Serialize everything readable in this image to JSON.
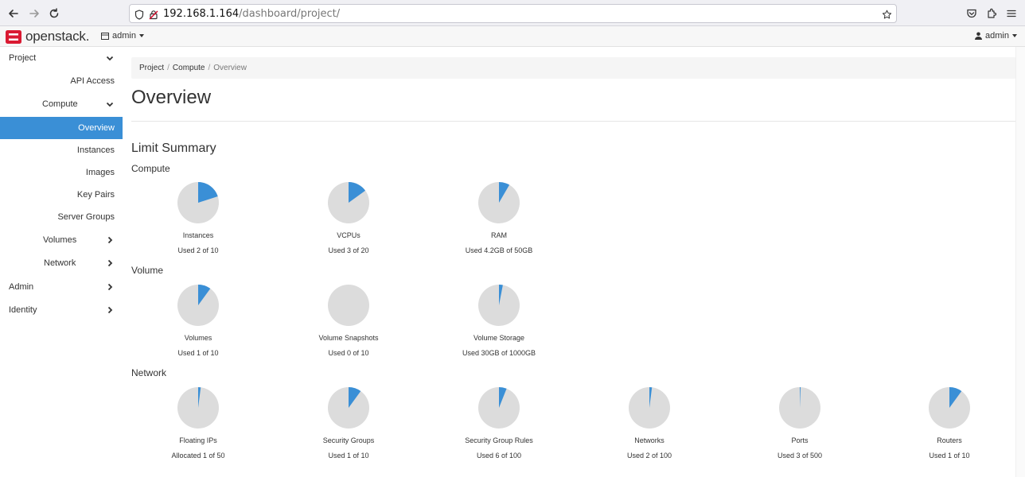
{
  "browser": {
    "url_host": "192.168.1.164",
    "url_path": "/dashboard/project/"
  },
  "header": {
    "logo_text": "openstack.",
    "project_selector": "admin",
    "user_menu": "admin"
  },
  "sidebar": {
    "items": [
      {
        "label": "Project"
      },
      {
        "label": "API Access"
      },
      {
        "label": "Compute"
      },
      {
        "label": "Overview"
      },
      {
        "label": "Instances"
      },
      {
        "label": "Images"
      },
      {
        "label": "Key Pairs"
      },
      {
        "label": "Server Groups"
      },
      {
        "label": "Volumes"
      },
      {
        "label": "Network"
      },
      {
        "label": "Admin"
      },
      {
        "label": "Identity"
      }
    ]
  },
  "breadcrumb": {
    "items": [
      "Project",
      "Compute",
      "Overview"
    ],
    "separator": "/"
  },
  "page": {
    "title": "Overview",
    "limit_summary_heading": "Limit Summary"
  },
  "colors": {
    "accent": "#3a8fd6",
    "pie_bg": "#dcdcdc"
  },
  "limits": {
    "compute": {
      "heading": "Compute",
      "items": [
        {
          "name": "Instances",
          "usage": "Used 2 of 10",
          "fraction": 0.2
        },
        {
          "name": "VCPUs",
          "usage": "Used 3 of 20",
          "fraction": 0.15
        },
        {
          "name": "RAM",
          "usage": "Used 4.2GB of 50GB",
          "fraction": 0.084
        }
      ]
    },
    "volume": {
      "heading": "Volume",
      "items": [
        {
          "name": "Volumes",
          "usage": "Used 1 of 10",
          "fraction": 0.1
        },
        {
          "name": "Volume Snapshots",
          "usage": "Used 0 of 10",
          "fraction": 0.0
        },
        {
          "name": "Volume Storage",
          "usage": "Used 30GB of 1000GB",
          "fraction": 0.03
        }
      ]
    },
    "network": {
      "heading": "Network",
      "items": [
        {
          "name": "Floating IPs",
          "usage": "Allocated 1 of 50",
          "fraction": 0.02
        },
        {
          "name": "Security Groups",
          "usage": "Used 1 of 10",
          "fraction": 0.1
        },
        {
          "name": "Security Group Rules",
          "usage": "Used 6 of 100",
          "fraction": 0.06
        },
        {
          "name": "Networks",
          "usage": "Used 2 of 100",
          "fraction": 0.02
        },
        {
          "name": "Ports",
          "usage": "Used 3 of 500",
          "fraction": 0.006
        },
        {
          "name": "Routers",
          "usage": "Used 1 of 10",
          "fraction": 0.1
        }
      ]
    }
  }
}
